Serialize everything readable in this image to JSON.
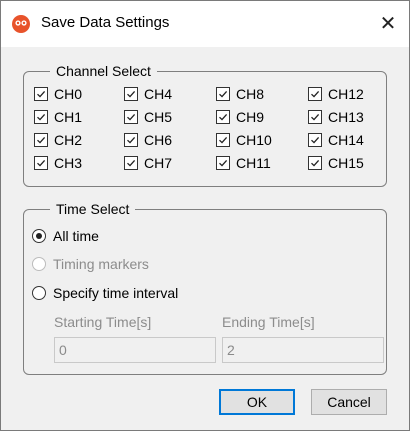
{
  "dialog": {
    "title": "Save Data Settings",
    "close_glyph": "✕"
  },
  "channel_select": {
    "title": "Channel Select",
    "channels": [
      {
        "label": "CH0",
        "checked": true
      },
      {
        "label": "CH4",
        "checked": true
      },
      {
        "label": "CH8",
        "checked": true
      },
      {
        "label": "CH12",
        "checked": true
      },
      {
        "label": "CH1",
        "checked": true
      },
      {
        "label": "CH5",
        "checked": true
      },
      {
        "label": "CH9",
        "checked": true
      },
      {
        "label": "CH13",
        "checked": true
      },
      {
        "label": "CH2",
        "checked": true
      },
      {
        "label": "CH6",
        "checked": true
      },
      {
        "label": "CH10",
        "checked": true
      },
      {
        "label": "CH14",
        "checked": true
      },
      {
        "label": "CH3",
        "checked": true
      },
      {
        "label": "CH7",
        "checked": true
      },
      {
        "label": "CH11",
        "checked": true
      },
      {
        "label": "CH15",
        "checked": true
      }
    ]
  },
  "time_select": {
    "title": "Time Select",
    "options": [
      {
        "label": "All time",
        "selected": true,
        "disabled": false
      },
      {
        "label": "Timing markers",
        "selected": false,
        "disabled": true
      },
      {
        "label": "Specify time interval",
        "selected": false,
        "disabled": false
      }
    ],
    "starting_label": "Starting Time[s]",
    "starting_value": "0",
    "ending_label": "Ending Time[s]",
    "ending_value": "2"
  },
  "buttons": {
    "ok": "OK",
    "cancel": "Cancel"
  },
  "colors": {
    "app_icon": "#e8532b",
    "accent": "#0078d7"
  }
}
